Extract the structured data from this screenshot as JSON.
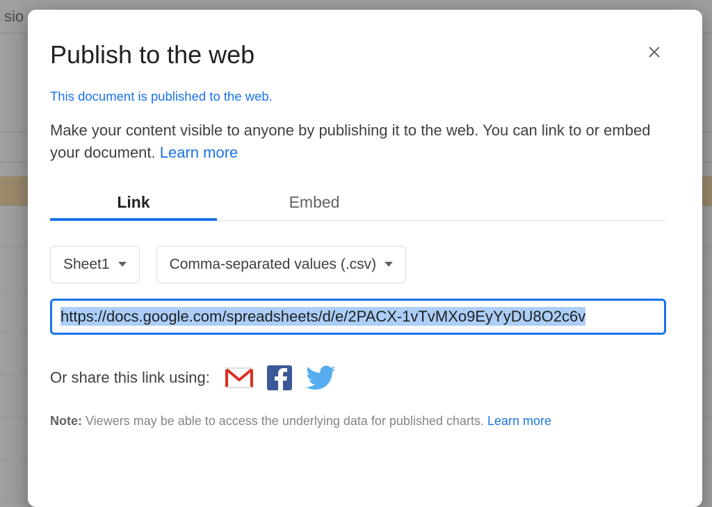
{
  "background": {
    "partial_text": "sio"
  },
  "dialog": {
    "title": "Publish to the web",
    "status_link": "This document is published to the web.",
    "description_pre": "Make your content visible to anyone by publishing it to the web. You can link to or embed your document. ",
    "description_learn_more": "Learn more",
    "tabs": {
      "link": "Link",
      "embed": "Embed"
    },
    "sheet_dropdown": "Sheet1",
    "format_dropdown": "Comma-separated values (.csv)",
    "url": "https://docs.google.com/spreadsheets/d/e/2PACX-1vTvMXo9EyYyDU8O2c6v",
    "share_label": "Or share this link using:",
    "note_label": "Note:",
    "note_text": " Viewers may be able to access the underlying data for published charts. ",
    "note_learn_more": "Learn more"
  }
}
